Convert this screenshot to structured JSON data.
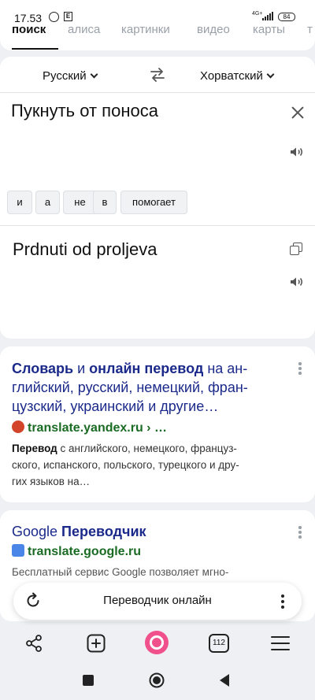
{
  "status_bar": {
    "time": "17.53",
    "network": "4G+",
    "battery": "84"
  },
  "tabs": [
    {
      "label": "поиск",
      "active": true
    },
    {
      "label": "алиса"
    },
    {
      "label": "картинки"
    },
    {
      "label": "видео"
    },
    {
      "label": "карты"
    },
    {
      "label": "т"
    }
  ],
  "translator": {
    "source_lang": "Русский",
    "target_lang": "Хорватский",
    "source_text": "Пукнуть от поноса",
    "chips": [
      "и",
      "а",
      "не",
      "в",
      "помогает"
    ],
    "translation": "Prdnuti od proljeva"
  },
  "results": [
    {
      "title_parts": [
        {
          "text": "Словарь",
          "bold": true
        },
        {
          "text": " и ",
          "bold": false
        },
        {
          "text": "онлайн перевод",
          "bold": true
        },
        {
          "text": " на ан-",
          "bold": false
        }
      ],
      "title_line2": "глийский, русский, немецкий, фран-",
      "title_line3": "цузский, украинский и другие…",
      "host": "translate.yandex.ru",
      "host_suffix": " › …",
      "desc_bold": "Перевод",
      "desc_line1": " с английского, немецкого, француз-",
      "desc_line2": "ского, испанского, польского, турецкого и дру-",
      "desc_line3": "гих языков на…",
      "favicon_color": "#d2452a"
    },
    {
      "title_a": "Google ",
      "title_b": "Переводчик",
      "host": "translate.google.ru",
      "desc": "Бесплатный сервис Google позволяет мгно-",
      "favicon_color": "#4a86e8"
    }
  ],
  "search_pill": {
    "query": "Переводчик онлайн"
  },
  "bottom_bar": {
    "tabs_count": "112"
  },
  "colors": {
    "link_title": "#1b2a8a",
    "host_green": "#1a6b24",
    "alice": "#f0508c"
  }
}
